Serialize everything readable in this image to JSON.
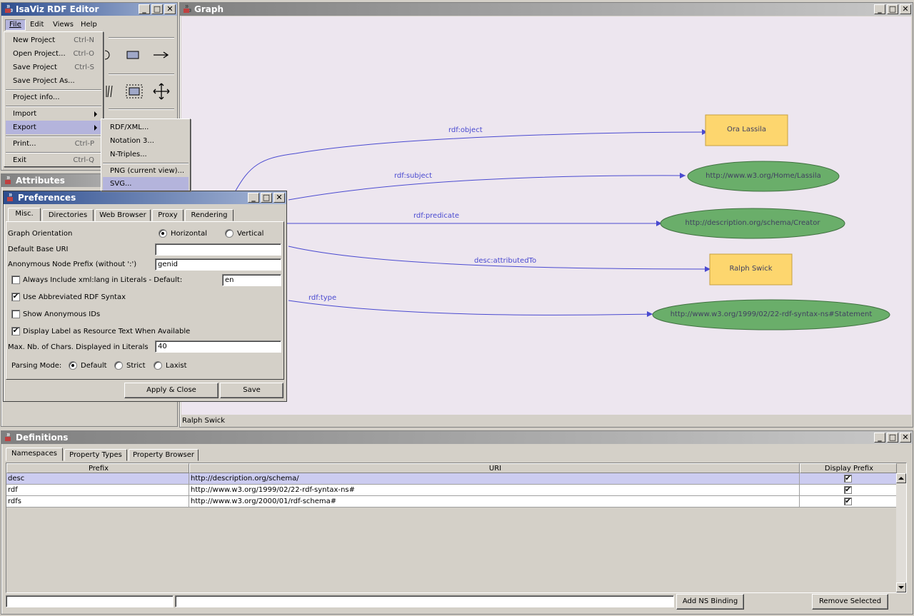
{
  "editor": {
    "title": "IsaViz RDF Editor",
    "menubar": [
      "File",
      "Edit",
      "Views",
      "Help"
    ]
  },
  "file_menu": {
    "items": [
      {
        "label": "New Project",
        "accel": "Ctrl-N"
      },
      {
        "label": "Open Project...",
        "accel": "Ctrl-O"
      },
      {
        "label": "Save Project",
        "accel": "Ctrl-S"
      },
      {
        "label": "Save Project As...",
        "accel": ""
      },
      {
        "label": "Project info...",
        "accel": ""
      },
      {
        "label": "Import",
        "accel": ""
      },
      {
        "label": "Export",
        "accel": ""
      },
      {
        "label": "Print...",
        "accel": "Ctrl-P"
      },
      {
        "label": "Exit",
        "accel": "Ctrl-Q"
      }
    ]
  },
  "export_menu": {
    "items": [
      "RDF/XML...",
      "Notation 3...",
      "N-Triples...",
      "PNG (current view)...",
      "SVG..."
    ]
  },
  "attributes": {
    "title": "Attributes"
  },
  "preferences": {
    "title": "Preferences",
    "tabs": [
      "Misc.",
      "Directories",
      "Web Browser",
      "Proxy",
      "Rendering"
    ],
    "graph_orientation_label": "Graph Orientation",
    "orientation_horizontal": "Horizontal",
    "orientation_vertical": "Vertical",
    "default_base_uri_label": "Default Base URI",
    "default_base_uri_value": "",
    "anon_prefix_label": "Anonymous Node Prefix (without ':')",
    "anon_prefix_value": "genid",
    "xml_lang_label": "Always Include xml:lang in Literals - Default:",
    "xml_lang_value": "en",
    "abbrev_label": "Use Abbreviated RDF Syntax",
    "show_anon_label": "Show Anonymous IDs",
    "display_label_label": "Display Label as Resource Text When Available",
    "max_chars_label": "Max. Nb. of Chars. Displayed in Literals",
    "max_chars_value": "40",
    "parsing_mode_label": "Parsing Mode:",
    "parsing_default": "Default",
    "parsing_strict": "Strict",
    "parsing_laxist": "Laxist",
    "apply_close": "Apply & Close",
    "save": "Save"
  },
  "graph": {
    "title": "Graph",
    "status": "Ralph Swick",
    "edges": [
      "rdf:object",
      "rdf:subject",
      "rdf:predicate",
      "desc:attributedTo",
      "rdf:type"
    ],
    "nodes": [
      "Ora Lassila",
      "http://www.w3.org/Home/Lassila",
      "http://description.org/schema/Creator",
      "Ralph Swick",
      "http://www.w3.org/1999/02/22-rdf-syntax-ns#Statement"
    ],
    "colors": {
      "literal": "#fdd66e",
      "resource": "#6aae6a",
      "edge": "#4a4ad0",
      "background": "#ede6ef"
    }
  },
  "definitions": {
    "title": "Definitions",
    "tabs": [
      "Namespaces",
      "Property Types",
      "Property Browser"
    ],
    "columns": [
      "Prefix",
      "URI",
      "Display Prefix"
    ],
    "rows": [
      {
        "prefix": "desc",
        "uri": "http://description.org/schema/",
        "display": "✔"
      },
      {
        "prefix": "rdf",
        "uri": "http://www.w3.org/1999/02/22-rdf-syntax-ns#",
        "display": "✔"
      },
      {
        "prefix": "rdfs",
        "uri": "http://www.w3.org/2000/01/rdf-schema#",
        "display": "✔"
      }
    ],
    "add_ns": "Add NS Binding",
    "remove": "Remove Selected"
  }
}
